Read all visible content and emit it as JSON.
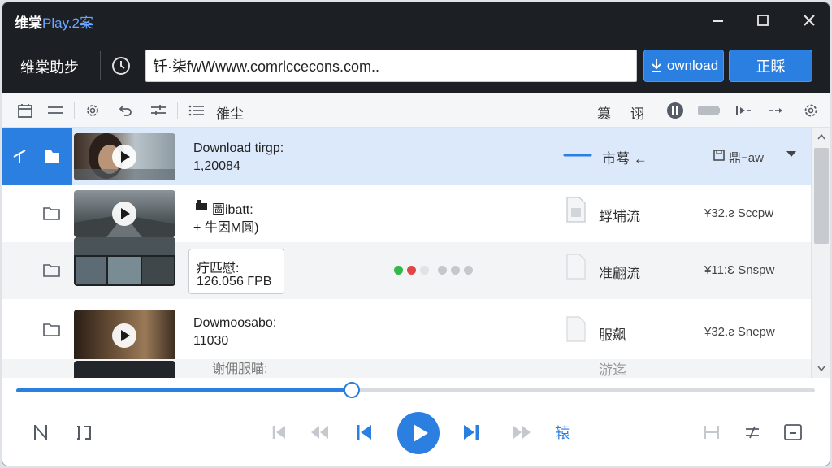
{
  "window": {
    "title_main": "维棠",
    "title_version": "Play.2案",
    "minimize_label": "",
    "maximize_label": "",
    "close_label": ""
  },
  "urlbar": {
    "brand": "维棠助步",
    "url_value": "钎·柒fwWwww.comrlccecons.com..",
    "download_label": "ownload",
    "start_label": "正睬"
  },
  "toolbar": {
    "list_label": "雒尘",
    "right_label_1": "篡",
    "right_label_2": "诩"
  },
  "list": {
    "rows": [
      {
        "title": "Download tirgp:",
        "sub": "1,20084",
        "name": "市蓦 ←",
        "speed": "鼎−aw"
      },
      {
        "title": "圖ibatt:",
        "sub": "+ 牛因M圓)",
        "name": "蜉埔流",
        "speed": "¥32.ƨ Sccpw"
      },
      {
        "title": "疔匹慰:",
        "sub": "126.056 ΓΡΒ",
        "name": "准翩流",
        "speed": "¥11:Ɛ Snspw"
      },
      {
        "title": "Dowmoosabo:",
        "sub": "11030",
        "name": "服飙",
        "speed": "¥32.ƨ Snepw"
      },
      {
        "title": "谢佣服瞄:",
        "sub": "",
        "name": "游迄",
        "speed": ""
      }
    ]
  },
  "progress": {
    "fraction": 0.42
  },
  "controls": {
    "speed_label": "辕"
  },
  "colors": {
    "accent": "#2a7fe0",
    "titlebar": "#1c1f24",
    "selected_row": "#dce9fb"
  }
}
